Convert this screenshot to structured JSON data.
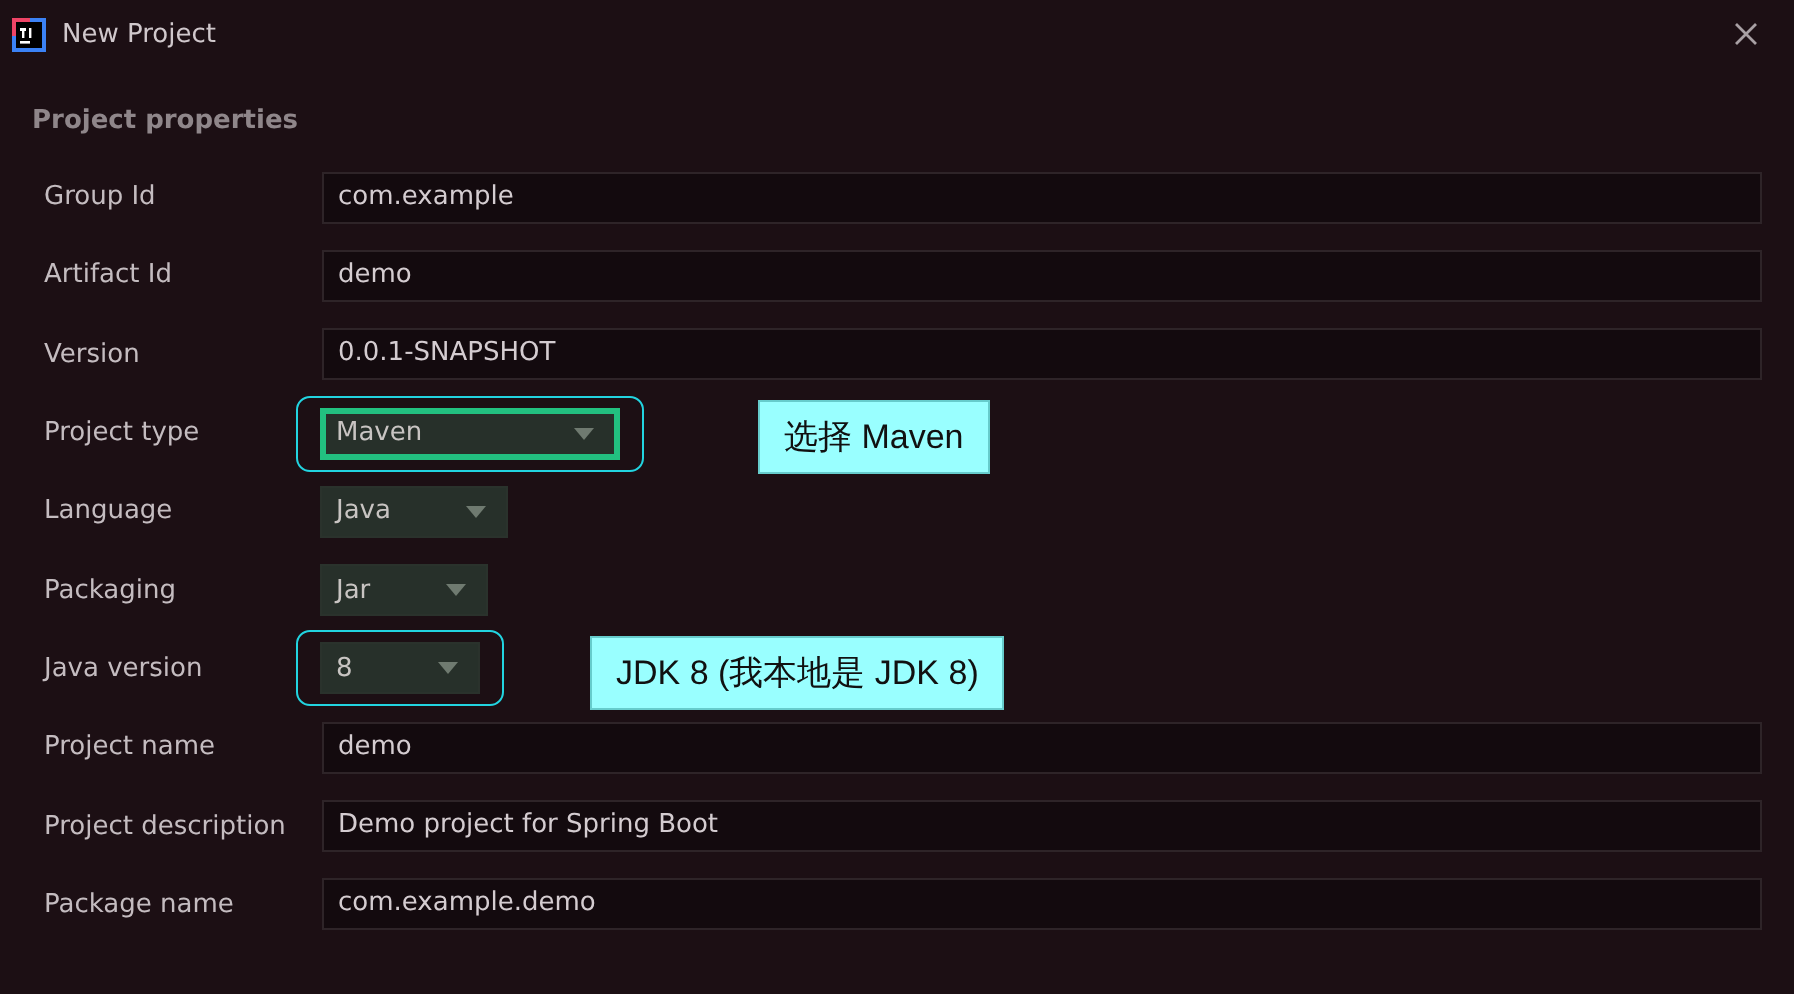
{
  "window": {
    "title": "New Project"
  },
  "section": {
    "title": "Project properties"
  },
  "fields": [
    {
      "label": "Group Id",
      "kind": "text",
      "value": "com.example",
      "focused": false,
      "highlighted": false
    },
    {
      "label": "Artifact Id",
      "kind": "text",
      "value": "demo",
      "focused": false,
      "highlighted": false
    },
    {
      "label": "Version",
      "kind": "text",
      "value": "0.0.1-SNAPSHOT",
      "focused": false,
      "highlighted": false
    },
    {
      "label": "Project type",
      "kind": "dropdown",
      "value": "Maven",
      "focused": true,
      "highlighted": true,
      "callout": "选择 Maven"
    },
    {
      "label": "Language",
      "kind": "dropdown",
      "value": "Java",
      "focused": false,
      "highlighted": false
    },
    {
      "label": "Packaging",
      "kind": "dropdown",
      "value": "Jar",
      "focused": false,
      "highlighted": false
    },
    {
      "label": "Java version",
      "kind": "dropdown",
      "value": "8",
      "focused": false,
      "highlighted": true,
      "callout": "JDK 8 (我本地是 JDK 8)"
    },
    {
      "label": "Project name",
      "kind": "text",
      "value": "demo",
      "focused": false,
      "highlighted": false
    },
    {
      "label": "Project description",
      "kind": "text",
      "value": "Demo project for Spring Boot",
      "focused": false,
      "highlighted": false
    },
    {
      "label": "Package name",
      "kind": "text",
      "value": "com.example.demo",
      "focused": false,
      "highlighted": false
    }
  ]
}
